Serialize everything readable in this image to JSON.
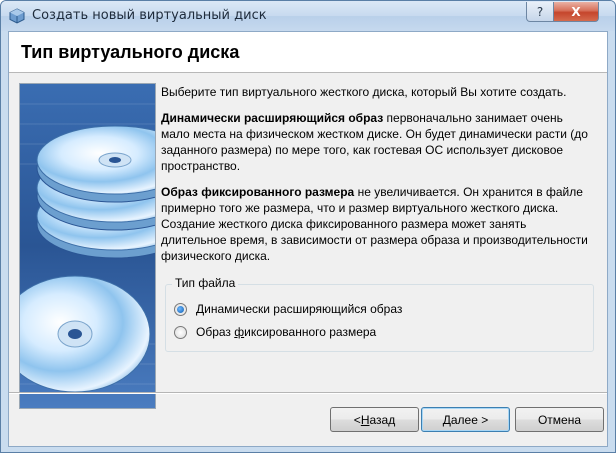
{
  "window": {
    "title": "Создать новый виртуальный диск",
    "help_label": "?",
    "close_label": "X"
  },
  "header": {
    "title": "Тип виртуального диска"
  },
  "content": {
    "intro": "Выберите тип виртуального жесткого диска, который Вы хотите создать.",
    "dynamic_bold": "Динамически расширяющийся образ",
    "dynamic_rest": " первоначально занимает очень мало места на физическом жестком диске. Он будет динамически расти (до заданного размера) по мере того, как гостевая ОС использует дисковое пространство.",
    "fixed_bold": "Образ фиксированного размера",
    "fixed_rest": " не увеличивается. Он хранится в файле примерно того же размера, что и размер виртуального жесткого диска. Создание жесткого диска фиксированного размера может занять длительное время, в зависимости от размера образа и производительности физического диска."
  },
  "file_type": {
    "label": "Тип файла",
    "options": [
      {
        "pre": "",
        "mnemonic": "Д",
        "post": "инамически расширяющийся образ",
        "selected": true
      },
      {
        "pre": "Образ ",
        "mnemonic": "ф",
        "post": "иксированного размера",
        "selected": false
      }
    ]
  },
  "buttons": {
    "back": {
      "pre": "< ",
      "mnemonic": "Н",
      "post": "азад"
    },
    "next": {
      "pre": "",
      "mnemonic": "Д",
      "post": "алее >"
    },
    "cancel": "Отмена"
  },
  "icons": {
    "app": "virtualbox-icon",
    "illustration": "disk-stack-illustration"
  },
  "colors": {
    "accent": "#0b5cb0",
    "sidebar": "#2f5fa3"
  }
}
